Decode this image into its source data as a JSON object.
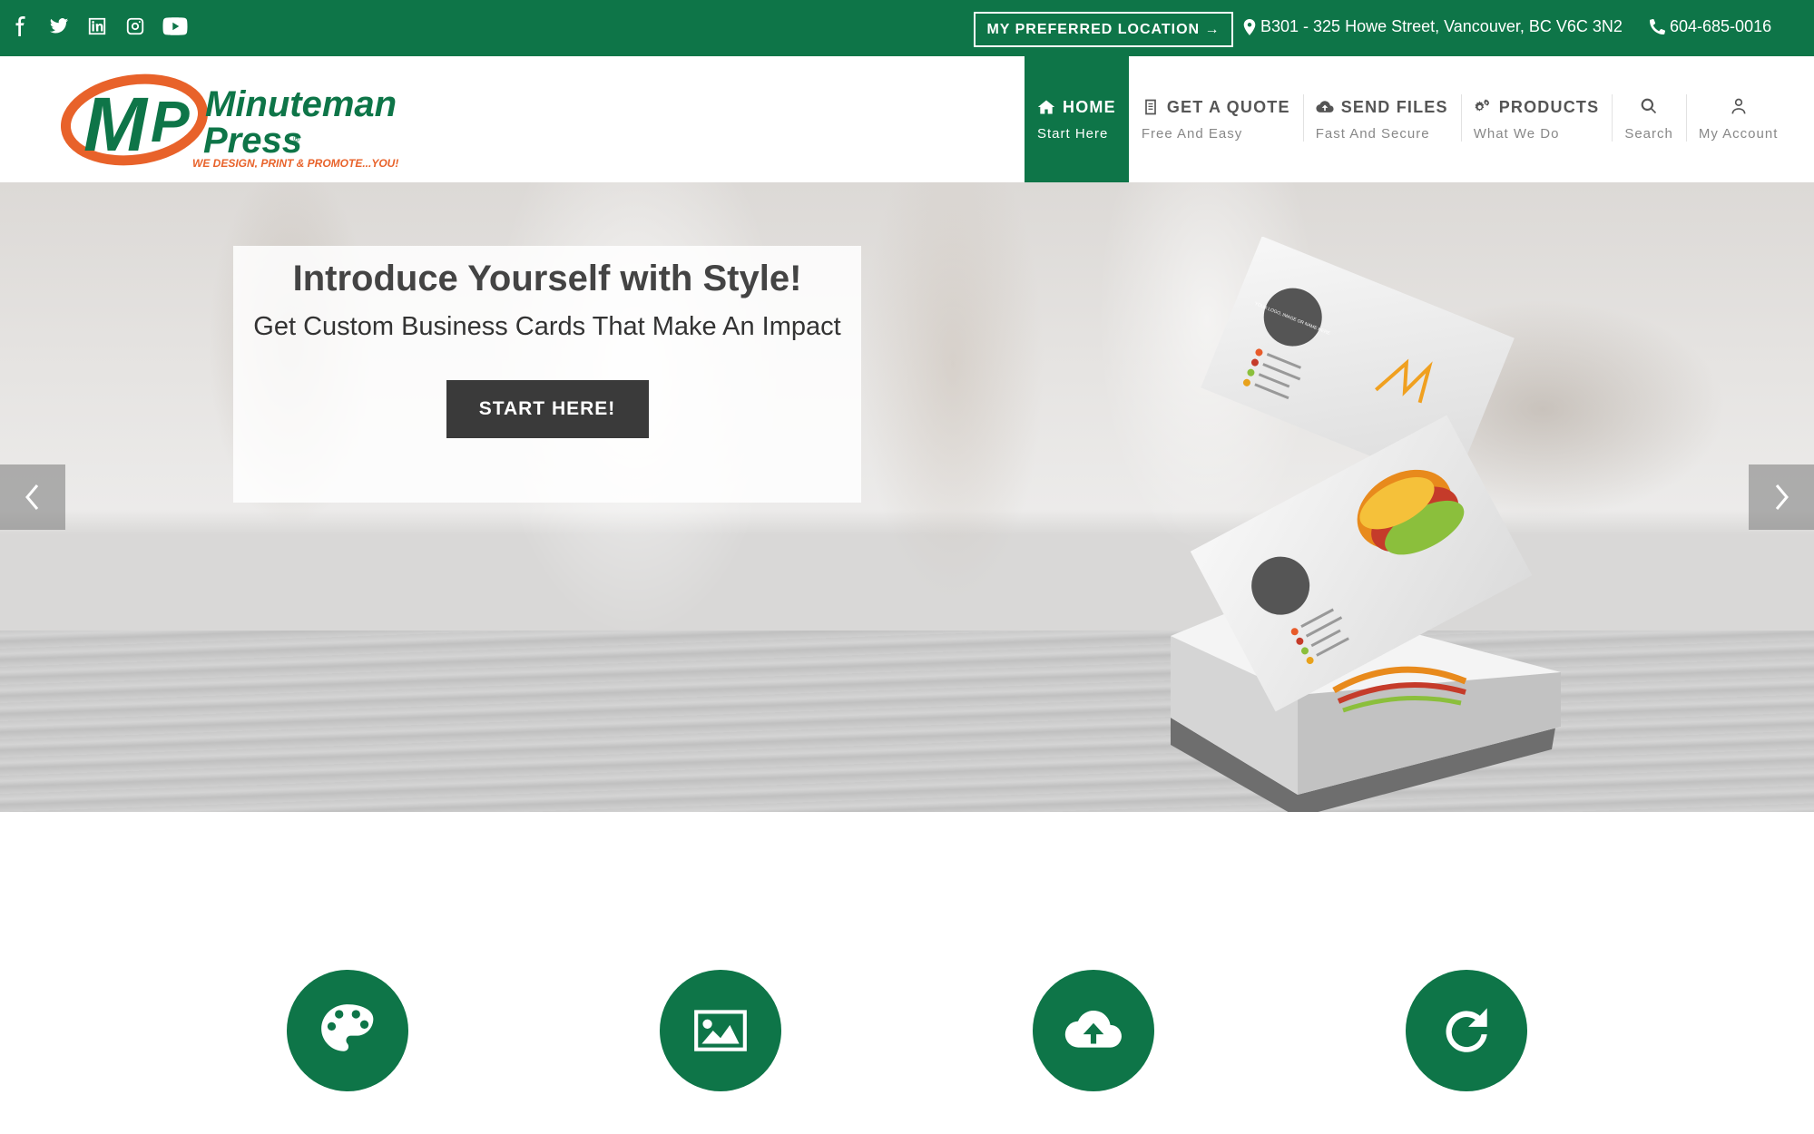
{
  "topbar": {
    "social": [
      "facebook-icon",
      "twitter-icon",
      "linkedin-icon",
      "instagram-icon",
      "youtube-icon"
    ],
    "preferred_location": "MY PREFERRED LOCATION →",
    "address": "B301 - 325 Howe Street, Vancouver, BC V6C 3N2",
    "phone": "604-685-0016",
    "background": "#0e7548"
  },
  "logo": {
    "line1": "Minuteman",
    "line2": "Press",
    "tagline": "WE DESIGN, PRINT & PROMOTE...YOU!"
  },
  "nav": {
    "items": [
      {
        "title": "HOME",
        "subtitle": "Start Here",
        "icon": "home-icon",
        "active": true
      },
      {
        "title": "GET A QUOTE",
        "subtitle": "Free And Easy",
        "icon": "document-icon",
        "active": false
      },
      {
        "title": "SEND FILES",
        "subtitle": "Fast And Secure",
        "icon": "cloud-upload-icon",
        "active": false
      },
      {
        "title": "PRODUCTS",
        "subtitle": "What We Do",
        "icon": "gears-icon",
        "active": false
      },
      {
        "title": "",
        "subtitle": "Search",
        "icon": "search-icon",
        "active": false
      },
      {
        "title": "",
        "subtitle": "My Account",
        "icon": "user-icon",
        "active": false
      }
    ]
  },
  "hero": {
    "headline": "Introduce Yourself with Style!",
    "subheadline": "Get Custom Business Cards That Make An Impact",
    "cta": "START HERE!",
    "card_logo_text": "YOUR LOGO, IMAGE OR NAME HERE"
  },
  "features": [
    "palette-icon",
    "image-icon",
    "cloud-upload-icon",
    "refresh-icon"
  ]
}
